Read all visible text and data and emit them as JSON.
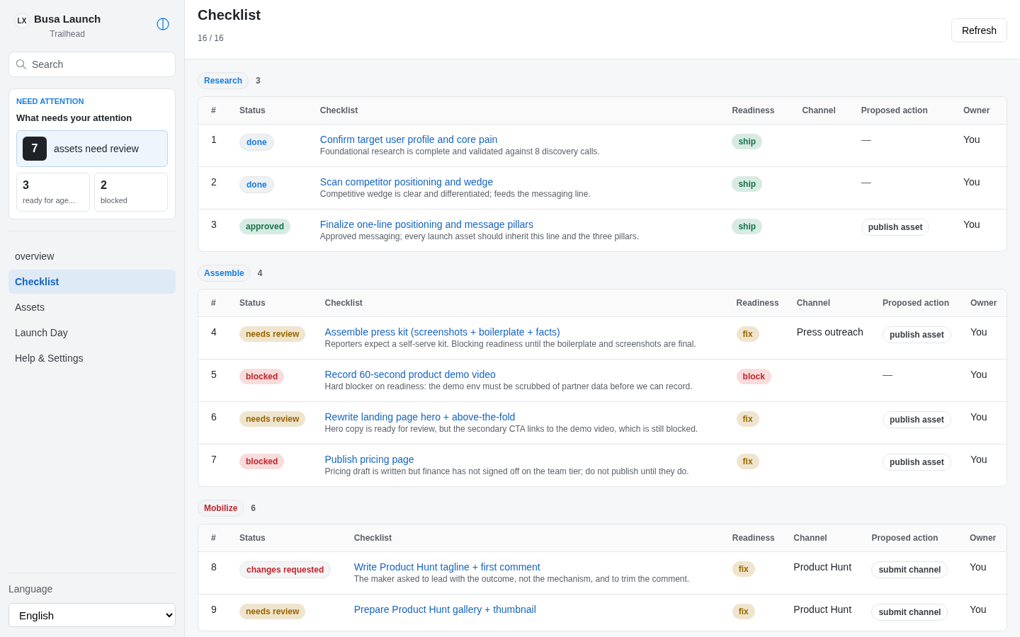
{
  "sidebar": {
    "logo": "LX",
    "title": "Busa Launch",
    "subtitle": "Trailhead",
    "search": {
      "placeholder": "Search"
    },
    "attention": {
      "eyebrow": "NEED ATTENTION",
      "heading": "What needs your attention",
      "primary": {
        "count": "7",
        "label": "assets need review"
      },
      "stats": [
        {
          "count": "3",
          "label": "ready for age..."
        },
        {
          "count": "2",
          "label": "blocked"
        }
      ]
    },
    "nav": [
      {
        "label": "overview",
        "selected": false
      },
      {
        "label": "Checklist",
        "selected": true
      },
      {
        "label": "Assets",
        "selected": false
      },
      {
        "label": "Launch Day",
        "selected": false
      },
      {
        "label": "Help & Settings",
        "selected": false
      }
    ],
    "language": {
      "label": "Language",
      "value": "English"
    }
  },
  "header": {
    "title": "Checklist",
    "progress": "16 / 16",
    "refresh": "Refresh"
  },
  "groups": [
    {
      "name": "Research",
      "color": "#1a7fe0",
      "count": "3",
      "columns": [
        "#",
        "Status",
        "Checklist",
        "Readiness",
        "Channel",
        "Proposed action",
        "Owner"
      ],
      "rows": [
        {
          "num": "1",
          "status": {
            "text": "done",
            "kind": "done"
          },
          "title": "Confirm target user profile and core pain",
          "desc": "Foundational research is complete and validated against 8 discovery calls.",
          "readiness": {
            "text": "ship",
            "kind": "ship"
          },
          "action": {
            "text": "—",
            "kind": "none"
          },
          "owner": "You"
        },
        {
          "num": "2",
          "status": {
            "text": "done",
            "kind": "done"
          },
          "title": "Scan competitor positioning and wedge",
          "desc": "Competitive wedge is clear and differentiated; feeds the messaging line.",
          "readiness": {
            "text": "ship",
            "kind": "ship"
          },
          "action": {
            "text": "—",
            "kind": "none"
          },
          "owner": "You"
        },
        {
          "num": "3",
          "status": {
            "text": "approved",
            "kind": "approved"
          },
          "title": "Finalize one-line positioning and message pillars",
          "desc": "Approved messaging; every launch asset should inherit this line and the three pillars.",
          "readiness": {
            "text": "ship",
            "kind": "ship"
          },
          "action": {
            "text": "publish asset",
            "kind": "pill"
          },
          "owner": "You"
        }
      ]
    },
    {
      "name": "Assemble",
      "color": "#1a7fe0",
      "count": "4",
      "columns": [
        "#",
        "Status",
        "Checklist",
        "Readiness",
        "Channel",
        "Proposed action",
        "Owner"
      ],
      "rows": [
        {
          "num": "4",
          "status": {
            "text": "needs review",
            "kind": "review"
          },
          "title": "Assemble press kit (screenshots + boilerplate + facts)",
          "desc": "Reporters expect a self-serve kit. Blocking readiness until the boilerplate and screenshots are final.",
          "readiness": {
            "text": "fix",
            "kind": "fix"
          },
          "channel": "Press outreach",
          "action": {
            "text": "publish asset",
            "kind": "pill"
          },
          "owner": "You"
        },
        {
          "num": "5",
          "status": {
            "text": "blocked",
            "kind": "blocked"
          },
          "title": "Record 60-second product demo video",
          "desc": "Hard blocker on readiness: the demo env must be scrubbed of partner data before we can record.",
          "readiness": {
            "text": "block",
            "kind": "block"
          },
          "action": {
            "text": "—",
            "kind": "none"
          },
          "owner": "You"
        },
        {
          "num": "6",
          "status": {
            "text": "needs review",
            "kind": "review"
          },
          "title": "Rewrite landing page hero + above-the-fold",
          "desc": "Hero copy is ready for review, but the secondary CTA links to the demo video, which is still blocked.",
          "readiness": {
            "text": "fix",
            "kind": "fix"
          },
          "action": {
            "text": "publish asset",
            "kind": "pill"
          },
          "owner": "You"
        },
        {
          "num": "7",
          "status": {
            "text": "blocked",
            "kind": "blocked"
          },
          "title": "Publish pricing page",
          "desc": "Pricing draft is written but finance has not signed off on the team tier; do not publish until they do.",
          "readiness": {
            "text": "fix",
            "kind": "fix"
          },
          "action": {
            "text": "publish asset",
            "kind": "pill"
          },
          "owner": "You"
        }
      ]
    },
    {
      "name": "Mobilize",
      "color": "#c0262d",
      "count": "6",
      "columns": [
        "#",
        "Status",
        "Checklist",
        "Readiness",
        "Channel",
        "Proposed action",
        "Owner"
      ],
      "rows": [
        {
          "num": "8",
          "status": {
            "text": "changes requested",
            "kind": "changes"
          },
          "title": "Write Product Hunt tagline + first comment",
          "desc": "The maker asked to lead with the outcome, not the mechanism, and to trim the comment.",
          "readiness": {
            "text": "fix",
            "kind": "fix"
          },
          "channel": "Product Hunt",
          "action": {
            "text": "submit channel",
            "kind": "pill"
          },
          "owner": "You"
        },
        {
          "num": "9",
          "status": {
            "text": "needs review",
            "kind": "review"
          },
          "title": "Prepare Product Hunt gallery + thumbnail",
          "readiness": {
            "text": "fix",
            "kind": "fix"
          },
          "channel": "Product Hunt",
          "action": {
            "text": "submit channel",
            "kind": "pill"
          },
          "owner": "You"
        }
      ]
    }
  ]
}
